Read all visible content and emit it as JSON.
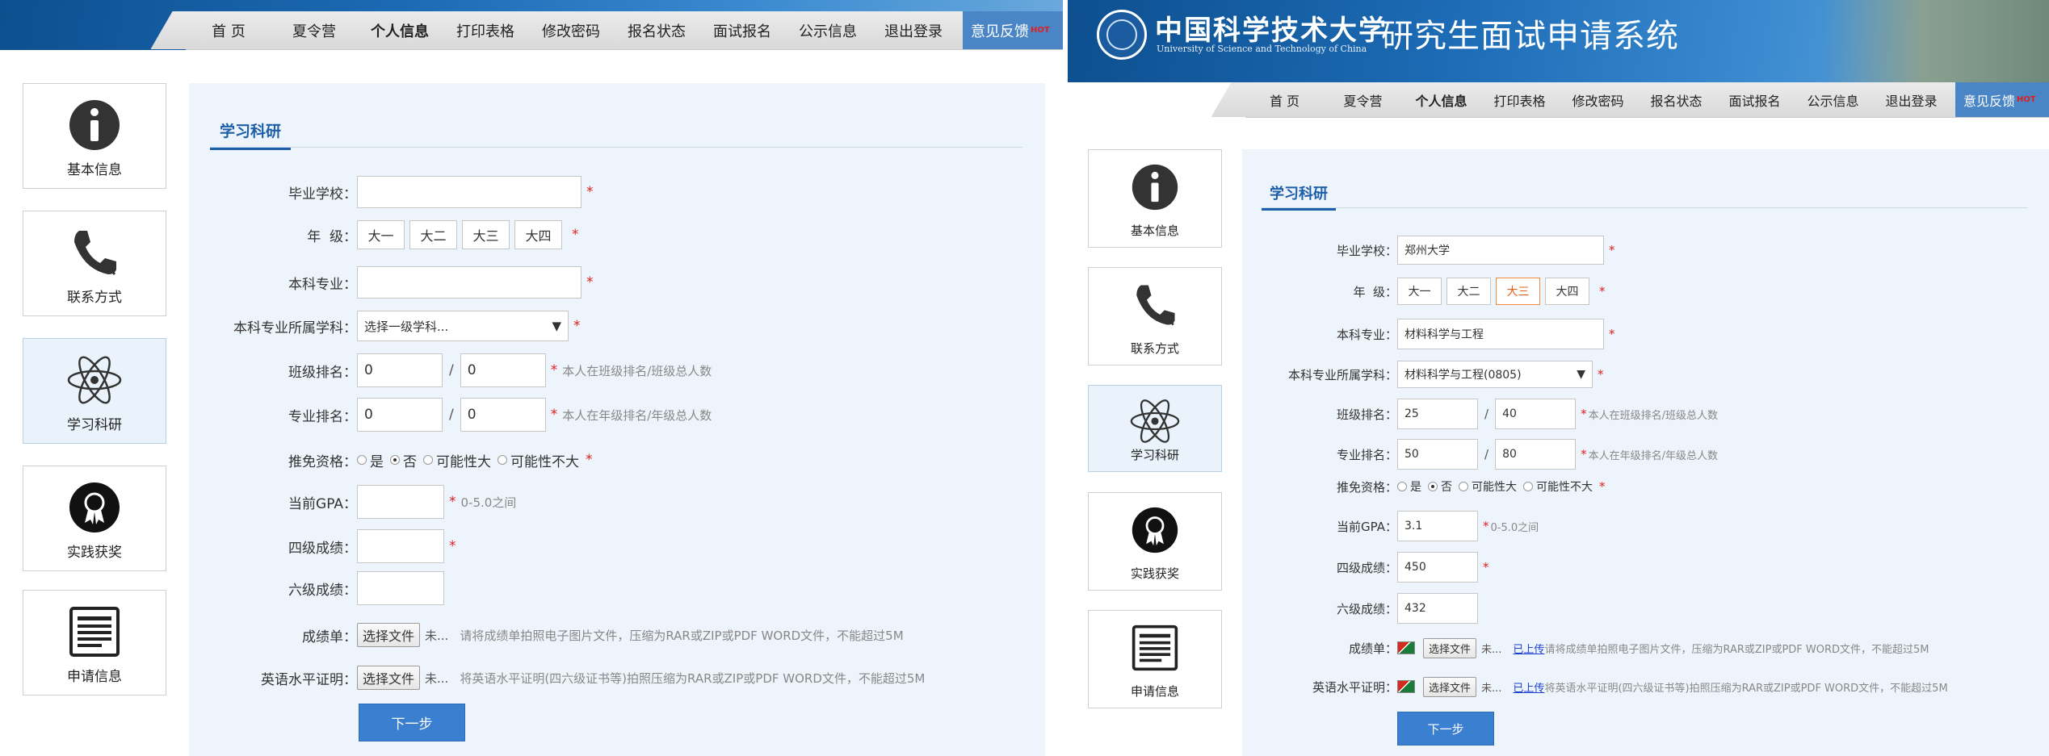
{
  "header": {
    "university_cn": "中国科学技术大学",
    "university_en": "University of Science and Technology of China",
    "system_title": "研究生面试申请系统"
  },
  "nav": {
    "items": [
      "首 页",
      "夏令营",
      "个人信息",
      "打印表格",
      "修改密码",
      "报名状态",
      "面试报名",
      "公示信息",
      "退出登录"
    ],
    "active_index": 2,
    "feedback_label": "意见反馈",
    "hot_badge": "HOT"
  },
  "sidebar": {
    "items": [
      {
        "label": "基本信息",
        "icon": "info-icon"
      },
      {
        "label": "联系方式",
        "icon": "phone-icon"
      },
      {
        "label": "学习科研",
        "icon": "atom-icon"
      },
      {
        "label": "实践获奖",
        "icon": "award-icon"
      },
      {
        "label": "申请信息",
        "icon": "document-icon"
      }
    ],
    "active_index": 2
  },
  "form": {
    "section_title": "学习科研",
    "labels": {
      "school": "毕业学校：",
      "grade": "年  级：",
      "major": "本科专业：",
      "discipline": "本科专业所属学科：",
      "class_rank": "班级排名：",
      "major_rank": "专业排名：",
      "exemption": "推免资格：",
      "gpa": "当前GPA：",
      "cet4": "四级成绩：",
      "cet6": "六级成绩：",
      "transcript": "成绩单：",
      "english_cert": "英语水平证明："
    },
    "grade_options": [
      "大一",
      "大二",
      "大三",
      "大四"
    ],
    "exemption_options": [
      "是",
      "否",
      "可能性大",
      "可能性不大"
    ],
    "required_mark": "*",
    "slash": "/",
    "hints": {
      "class_rank": "本人在班级排名/班级总人数",
      "major_rank": "本人在年级排名/年级总人数",
      "gpa": "0-5.0之间",
      "transcript": "请将成绩单拍照电子图片文件，压缩为RAR或ZIP或PDF WORD文件，不能超过5M",
      "english_cert": "将英语水平证明(四六级证书等)拍照压缩为RAR或ZIP或PDF WORD文件，不能超过5M",
      "transcript_right": "请将成绩单拍照电子图片文件，压缩为RAR或ZIP或PDF WORD文件，不能超过5M",
      "english_cert_right": "将英语水平证明(四六级证书等)拍照压缩为RAR或ZIP或PDF WORD文件，不能超过5M"
    },
    "file_button": "选择文件",
    "file_none": "未...",
    "uploaded_link": "已上传",
    "next_button": "下一步"
  },
  "left_values": {
    "school": "",
    "major": "",
    "discipline": "选择一级学科...",
    "class_rank_a": "0",
    "class_rank_b": "0",
    "major_rank_a": "0",
    "major_rank_b": "0",
    "gpa": "",
    "cet4": "",
    "cet6": "",
    "grade_selected": -1,
    "exemption_selected": 1
  },
  "right_values": {
    "school": "郑州大学",
    "major": "材料科学与工程",
    "discipline": "材料科学与工程(0805)",
    "class_rank_a": "25",
    "class_rank_b": "40",
    "major_rank_a": "50",
    "major_rank_b": "80",
    "gpa": "3.1",
    "cet4": "450",
    "cet6": "432",
    "grade_selected": 2,
    "exemption_selected": 1
  }
}
